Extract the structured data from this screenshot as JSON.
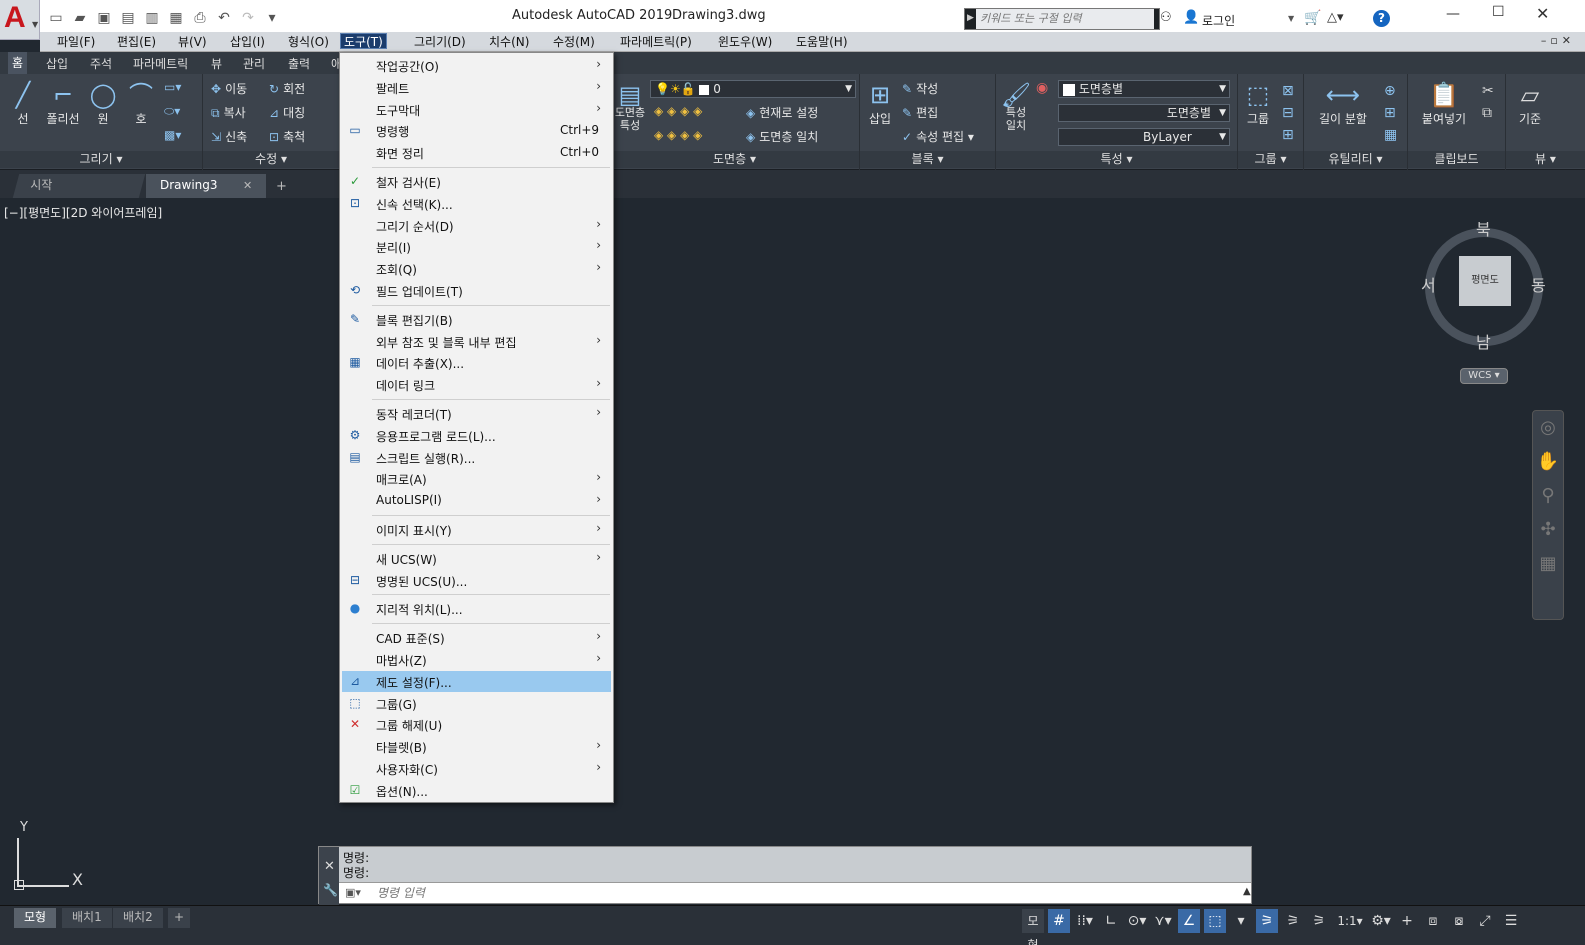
{
  "title": {
    "app": "Autodesk AutoCAD 2019",
    "document": "Drawing3.dwg",
    "logo": "A"
  },
  "search": {
    "placeholder": "키워드 또는 구절 입력"
  },
  "login": {
    "label": "로그인"
  },
  "menubar": {
    "items": [
      "파일(F)",
      "편집(E)",
      "뷰(V)",
      "삽입(I)",
      "형식(O)",
      "도구(T)",
      "그리기(D)",
      "치수(N)",
      "수정(M)",
      "파라메트릭(P)",
      "윈도우(W)",
      "도움말(H)"
    ],
    "active": "도구(T)"
  },
  "ribbon_tabs": [
    "홈",
    "삽입",
    "주석",
    "파라메트릭",
    "뷰",
    "관리",
    "출력",
    "애"
  ],
  "ribbon": {
    "draw": {
      "title": "그리기",
      "line": "선",
      "polyline": "폴리선",
      "circle": "원",
      "arc": "호"
    },
    "modify": {
      "title": "수정",
      "move": "이동",
      "rotate": "회전",
      "copy": "복사",
      "mirror": "대칭",
      "stretch": "신축",
      "scale": "축척"
    },
    "layers": {
      "title": "도면층",
      "layer_props": "도면층\n특성",
      "layer_value": "0",
      "set_current": "현재로 설정",
      "match_layer": "도면층 일치"
    },
    "block": {
      "title": "블록",
      "insert": "삽입",
      "create": "작성",
      "edit": "편집",
      "edit_attr": "속성 편집"
    },
    "properties": {
      "title": "특성",
      "match": "특성\n일치",
      "color": "도면층별",
      "linetype": "도면층별",
      "lineweight": "ByLayer"
    },
    "groups": {
      "title": "그룹",
      "group": "그룹"
    },
    "utilities": {
      "title": "유틸리티",
      "measure": "길이 분할"
    },
    "clipboard": {
      "title": "클립보드",
      "paste": "붙여넣기"
    },
    "view": {
      "title": "뷰",
      "base": "기준"
    }
  },
  "doc_tabs": {
    "start": "시작",
    "drawing": "Drawing3"
  },
  "viewport": {
    "label": "[−][평면도][2D 와이어프레임]"
  },
  "viewcube": {
    "north": "북",
    "south": "남",
    "east": "동",
    "west": "서",
    "face": "평면도",
    "wcs": "WCS"
  },
  "ucs": {
    "x": "X",
    "y": "Y"
  },
  "tools_menu": [
    {
      "label": "작업공간(O)",
      "submenu": true
    },
    {
      "label": "팔레트",
      "submenu": true
    },
    {
      "label": "도구막대",
      "submenu": true
    },
    {
      "label": "명령행",
      "shortcut": "Ctrl+9",
      "icon": "command-line-icon"
    },
    {
      "label": "화면 정리",
      "shortcut": "Ctrl+0"
    },
    {
      "sep": true
    },
    {
      "label": "철자 검사(E)",
      "icon": "spell-check-icon"
    },
    {
      "label": "신속 선택(K)...",
      "icon": "quick-select-icon"
    },
    {
      "label": "그리기 순서(D)",
      "submenu": true
    },
    {
      "label": "분리(I)",
      "submenu": true
    },
    {
      "label": "조회(Q)",
      "submenu": true
    },
    {
      "label": "필드 업데이트(T)",
      "icon": "update-field-icon"
    },
    {
      "sep": true
    },
    {
      "label": "블록 편집기(B)",
      "icon": "block-editor-icon"
    },
    {
      "label": "외부 참조 및 블록 내부 편집",
      "submenu": true
    },
    {
      "label": "데이터 추출(X)...",
      "icon": "data-extraction-icon"
    },
    {
      "label": "데이터 링크",
      "submenu": true
    },
    {
      "sep": true
    },
    {
      "label": "동작 레코더(T)",
      "submenu": true
    },
    {
      "label": "응용프로그램 로드(L)...",
      "icon": "load-app-icon"
    },
    {
      "label": "스크립트 실행(R)...",
      "icon": "run-script-icon"
    },
    {
      "label": "매크로(A)",
      "submenu": true
    },
    {
      "label": "AutoLISP(I)",
      "submenu": true
    },
    {
      "sep": true
    },
    {
      "label": "이미지 표시(Y)",
      "submenu": true
    },
    {
      "sep": true
    },
    {
      "label": "새 UCS(W)",
      "submenu": true
    },
    {
      "label": "명명된 UCS(U)...",
      "icon": "named-ucs-icon"
    },
    {
      "sep": true
    },
    {
      "label": "지리적 위치(L)...",
      "icon": "globe-icon"
    },
    {
      "sep": true
    },
    {
      "label": "CAD 표준(S)",
      "submenu": true
    },
    {
      "label": "마법사(Z)",
      "submenu": true
    },
    {
      "label": "제도 설정(F)...",
      "icon": "drafting-settings-icon",
      "highlighted": true
    },
    {
      "label": "그룹(G)",
      "icon": "group-icon"
    },
    {
      "label": "그룹 해제(U)",
      "icon": "ungroup-icon"
    },
    {
      "label": "타블렛(B)",
      "submenu": true
    },
    {
      "label": "사용자화(C)",
      "submenu": true
    },
    {
      "label": "옵션(N)...",
      "icon": "options-icon"
    }
  ],
  "command_line": {
    "history": [
      "명령:",
      "명령:"
    ],
    "placeholder": "명령 입력"
  },
  "layout_tabs": [
    "모형",
    "배치1",
    "배치2"
  ],
  "status": {
    "model": "모형",
    "scale": "1:1"
  },
  "colors": {
    "menu_highlight": "#99c9ef",
    "active_menu": "#1b3c6c",
    "canvas": "#212830",
    "ribbon": "#3c434c"
  }
}
